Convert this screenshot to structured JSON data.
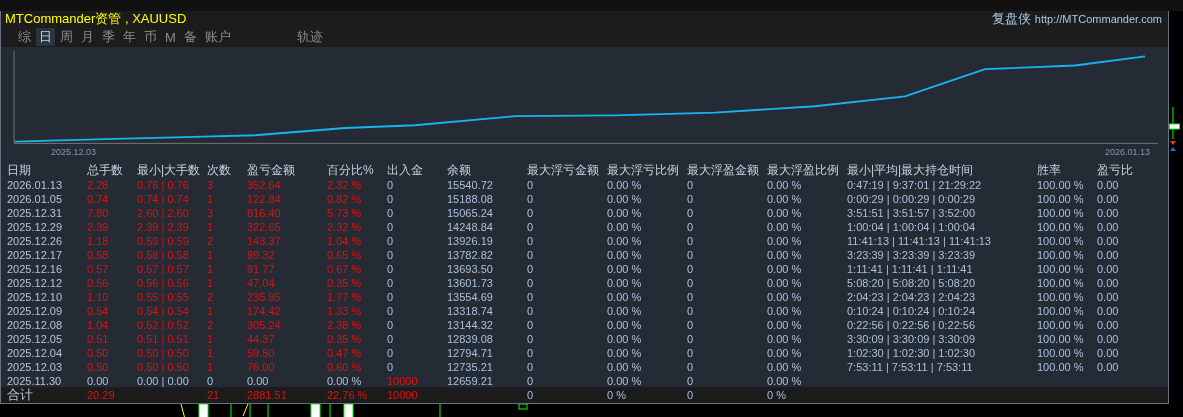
{
  "header": {
    "title": "MTCommander资管 , XAUUSD",
    "brand": "复盘侠",
    "link": "http://MTCommander.com"
  },
  "tabs": [
    {
      "label": "综",
      "selected": false
    },
    {
      "label": "日",
      "selected": true
    },
    {
      "label": "周",
      "selected": false
    },
    {
      "label": "月",
      "selected": false
    },
    {
      "label": "季",
      "selected": false
    },
    {
      "label": "年",
      "selected": false
    },
    {
      "label": "币",
      "selected": false
    },
    {
      "label": "M",
      "selected": false
    },
    {
      "label": "备",
      "selected": false
    },
    {
      "label": "账户",
      "selected": false
    },
    {
      "label": "轨迹",
      "selected": false
    }
  ],
  "equity_chart": {
    "start_label": "2025.12.03",
    "end_label": "2026.01.13"
  },
  "table": {
    "columns": [
      "日期",
      "总手数",
      "最小|大手数",
      "次数",
      "盈亏金额",
      "百分比%",
      "出入金",
      "余额",
      "最大浮亏金额",
      "最大浮亏比例",
      "最大浮盈金额",
      "最大浮盈比例",
      "最小|平均|最大持仓时间",
      "胜率",
      "盈亏比"
    ],
    "rows": [
      {
        "kind": "trade",
        "cells": [
          "2026.01.13",
          "2.28",
          "0.76 | 0.76",
          "3",
          "352.64",
          "2.32 %",
          "0",
          "15540.72",
          "0",
          "0.00 %",
          "0",
          "0.00 %",
          "0:47:19 | 9:37:01 | 21:29:22",
          "100.00 %",
          "0.00"
        ]
      },
      {
        "kind": "trade",
        "cells": [
          "2026.01.05",
          "0.74",
          "0.74 | 0.74",
          "1",
          "122.84",
          "0.82 %",
          "0",
          "15188.08",
          "0",
          "0.00 %",
          "0",
          "0.00 %",
          "0:00:29 | 0:00:29 | 0:00:29",
          "100.00 %",
          "0.00"
        ]
      },
      {
        "kind": "trade",
        "cells": [
          "2025.12.31",
          "7.80",
          "2.60 | 2.60",
          "3",
          "816.40",
          "5.73 %",
          "0",
          "15065.24",
          "0",
          "0.00 %",
          "0",
          "0.00 %",
          "3:51:51 | 3:51:57 | 3:52:00",
          "100.00 %",
          "0.00"
        ]
      },
      {
        "kind": "trade",
        "cells": [
          "2025.12.29",
          "2.39",
          "2.39 | 2.39",
          "1",
          "322.65",
          "2.32 %",
          "0",
          "14248.84",
          "0",
          "0.00 %",
          "0",
          "0.00 %",
          "1:00:04 | 1:00:04 | 1:00:04",
          "100.00 %",
          "0.00"
        ]
      },
      {
        "kind": "trade",
        "cells": [
          "2025.12.26",
          "1.18",
          "0.59 | 0.59",
          "2",
          "143.37",
          "1.04 %",
          "0",
          "13926.19",
          "0",
          "0.00 %",
          "0",
          "0.00 %",
          "11:41:13 | 11:41:13 | 11:41:13",
          "100.00 %",
          "0.00"
        ]
      },
      {
        "kind": "trade",
        "cells": [
          "2025.12.17",
          "0.58",
          "0.58 | 0.58",
          "1",
          "89.32",
          "0.65 %",
          "0",
          "13782.82",
          "0",
          "0.00 %",
          "0",
          "0.00 %",
          "3:23:39 | 3:23:39 | 3:23:39",
          "100.00 %",
          "0.00"
        ]
      },
      {
        "kind": "trade",
        "cells": [
          "2025.12.16",
          "0.57",
          "0.57 | 0.57",
          "1",
          "91.77",
          "0.67 %",
          "0",
          "13693.50",
          "0",
          "0.00 %",
          "0",
          "0.00 %",
          "1:11:41 | 1:11:41 | 1:11:41",
          "100.00 %",
          "0.00"
        ]
      },
      {
        "kind": "trade",
        "cells": [
          "2025.12.12",
          "0.56",
          "0.56 | 0.56",
          "1",
          "47.04",
          "0.35 %",
          "0",
          "13601.73",
          "0",
          "0.00 %",
          "0",
          "0.00 %",
          "5:08:20 | 5:08:20 | 5:08:20",
          "100.00 %",
          "0.00"
        ]
      },
      {
        "kind": "trade",
        "cells": [
          "2025.12.10",
          "1.10",
          "0.55 | 0.55",
          "2",
          "235.95",
          "1.77 %",
          "0",
          "13554.69",
          "0",
          "0.00 %",
          "0",
          "0.00 %",
          "2:04:23 | 2:04:23 | 2:04:23",
          "100.00 %",
          "0.00"
        ]
      },
      {
        "kind": "trade",
        "cells": [
          "2025.12.09",
          "0.54",
          "0.54 | 0.54",
          "1",
          "174.42",
          "1.33 %",
          "0",
          "13318.74",
          "0",
          "0.00 %",
          "0",
          "0.00 %",
          "0:10:24 | 0:10:24 | 0:10:24",
          "100.00 %",
          "0.00"
        ]
      },
      {
        "kind": "trade",
        "cells": [
          "2025.12.08",
          "1.04",
          "0.52 | 0.52",
          "2",
          "305.24",
          "2.38 %",
          "0",
          "13144.32",
          "0",
          "0.00 %",
          "0",
          "0.00 %",
          "0:22:56 | 0:22:56 | 0:22:56",
          "100.00 %",
          "0.00"
        ]
      },
      {
        "kind": "trade",
        "cells": [
          "2025.12.05",
          "0.51",
          "0.51 | 0.51",
          "1",
          "44.37",
          "0.35 %",
          "0",
          "12839.08",
          "0",
          "0.00 %",
          "0",
          "0.00 %",
          "3:30:09 | 3:30:09 | 3:30:09",
          "100.00 %",
          "0.00"
        ]
      },
      {
        "kind": "trade",
        "cells": [
          "2025.12.04",
          "0.50",
          "0.50 | 0.50",
          "1",
          "59.50",
          "0.47 %",
          "0",
          "12794.71",
          "0",
          "0.00 %",
          "0",
          "0.00 %",
          "1:02:30 | 1:02:30 | 1:02:30",
          "100.00 %",
          "0.00"
        ]
      },
      {
        "kind": "trade",
        "cells": [
          "2025.12.03",
          "0.50",
          "0.50 | 0.50",
          "1",
          "76.00",
          "0.60 %",
          "0",
          "12735.21",
          "0",
          "0.00 %",
          "0",
          "0.00 %",
          "7:53:11 | 7:53:11 | 7:53:11",
          "100.00 %",
          "0.00"
        ]
      },
      {
        "kind": "deposit",
        "cells": [
          "2025.11.30",
          "0.00",
          "0.00 | 0.00",
          "0",
          "0.00",
          "0.00 %",
          "10000",
          "12659.21",
          "0",
          "0.00 %",
          "0",
          "0.00 %"
        ]
      }
    ],
    "totals": {
      "label": "合计",
      "total_lots": "20.29",
      "trade_count": "21",
      "profit": "2881.51",
      "percent": "22.76 %",
      "deposit": "10000",
      "max_float_loss": "0",
      "max_float_loss_pct": "0 %",
      "max_float_profit": "0",
      "max_float_profit_pct": "0 %"
    }
  }
}
